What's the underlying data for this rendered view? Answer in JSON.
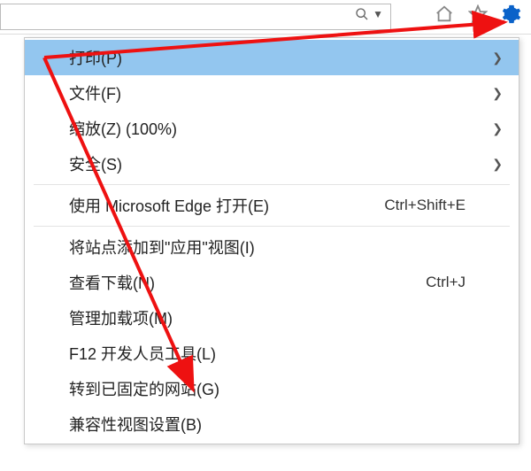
{
  "toolbar": {
    "dropdown_glyph": "▼"
  },
  "menu": {
    "print": {
      "label": "打印(P)"
    },
    "file": {
      "label": "文件(F)"
    },
    "zoom": {
      "label": "缩放(Z) (100%)"
    },
    "safety": {
      "label": "安全(S)"
    },
    "open_edge": {
      "label": "使用 Microsoft Edge 打开(E)",
      "shortcut": "Ctrl+Shift+E"
    },
    "add_site_app": {
      "label": "将站点添加到\"应用\"视图(I)"
    },
    "view_downloads": {
      "label": "查看下载(N)",
      "shortcut": "Ctrl+J"
    },
    "manage_addons": {
      "label": "管理加载项(M)"
    },
    "f12": {
      "label": "F12 开发人员工具(L)"
    },
    "goto_pinned": {
      "label": "转到已固定的网站(G)"
    },
    "compat": {
      "label": "兼容性视图设置(B)"
    }
  },
  "glyphs": {
    "submenu_arrow": "❯"
  }
}
